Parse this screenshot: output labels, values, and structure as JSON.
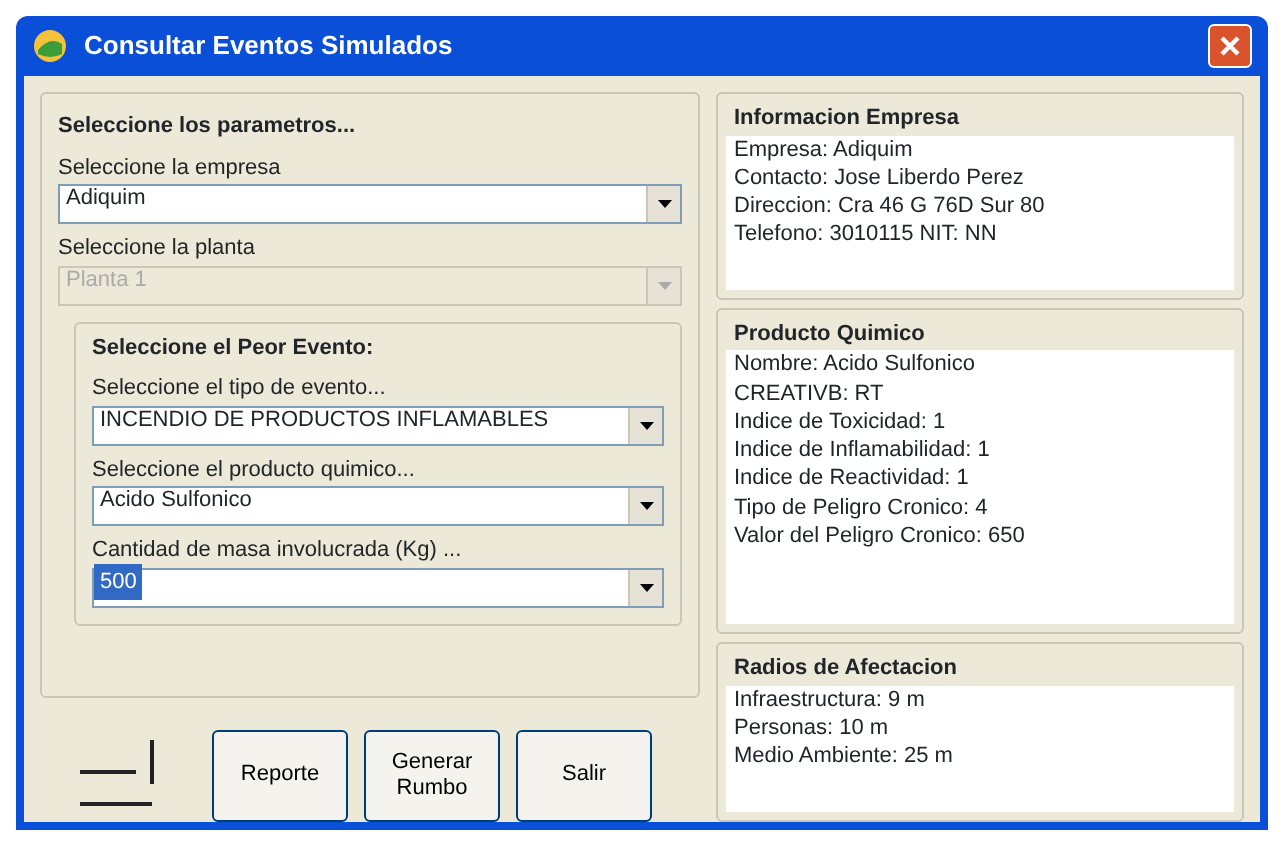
{
  "window": {
    "title": "Consultar Eventos Simulados"
  },
  "parameters": {
    "title": "Seleccione los parametros...",
    "fields": [
      {
        "label": "Seleccione la empresa",
        "value": "Adiquim",
        "disabled": false,
        "highlighted": false
      },
      {
        "label": "Seleccione la planta",
        "value": "Planta 1",
        "disabled": true,
        "highlighted": false
      }
    ]
  },
  "worst_event": {
    "title": "Seleccione el Peor Evento:",
    "fields": [
      {
        "label": "Seleccione el tipo de evento...",
        "value": "INCENDIO DE PRODUCTOS INFLAMABLES",
        "disabled": false,
        "highlighted": false
      },
      {
        "label": "Seleccione el producto quimico...",
        "value": "Acido Sulfonico",
        "disabled": false,
        "highlighted": false
      },
      {
        "label": "Cantidad de masa involucrada (Kg) ...",
        "value": "500",
        "disabled": false,
        "highlighted": true
      }
    ]
  },
  "buttons": [
    {
      "label": "Reporte"
    },
    {
      "label": "Generar\nRumbo"
    },
    {
      "label": "Salir"
    }
  ],
  "panels": [
    {
      "title": "Informacion Empresa",
      "lines": [
        "Empresa: Adiquim",
        "Contacto: Jose Liberdo Perez",
        "Direccion: Cra 46 G 76D Sur 80",
        "Telefono: 3010115    NIT: NN"
      ]
    },
    {
      "title": "Producto Quimico",
      "lines": [
        "Nombre: Acido Sulfonico",
        "CREATIVB: RT",
        "Indice de Toxicidad: 1",
        "Indice de Inflamabilidad: 1",
        "Indice de Reactividad: 1",
        "Tipo de Peligro Cronico: 4",
        "Valor del Peligro Cronico: 650"
      ]
    },
    {
      "title": "Radios de Afectacion",
      "lines": [
        "Infraestructura: 9 m",
        "Personas: 10 m",
        "Medio Ambiente: 25 m"
      ]
    }
  ]
}
